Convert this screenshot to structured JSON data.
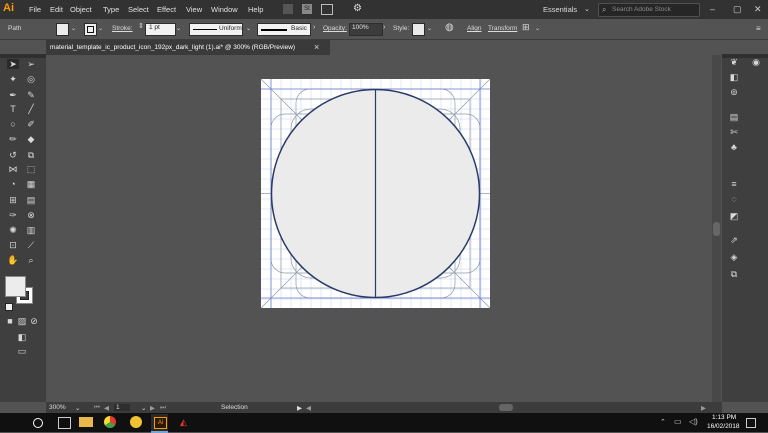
{
  "app": {
    "logo": "Ai"
  },
  "menu": [
    "File",
    "Edit",
    "Object",
    "Type",
    "Select",
    "Effect",
    "View",
    "Window",
    "Help"
  ],
  "workspace": "Essentials",
  "search": {
    "placeholder": "Search Adobe Stock"
  },
  "control": {
    "selection": "Path",
    "stroke_label": "Stroke:",
    "stroke_weight": "1 pt",
    "profile": "Uniform",
    "brush": "Basic",
    "opacity_label": "Opacity:",
    "opacity_value": "100%",
    "style_label": "Style:",
    "align": "Align",
    "transform": "Transform",
    "st_badge": "St"
  },
  "document": {
    "tab_title": "material_template_ic_product_icon_192px_dark_light (1).ai* @ 300% (RGB/Preview)",
    "close": "×"
  },
  "status": {
    "zoom": "300%",
    "artboard_num": "1",
    "mode": "Selection"
  },
  "taskbar": {
    "time": "1:13 PM",
    "date": "16/02/2018"
  },
  "colors": {
    "menubar": "#323232",
    "panel": "#535353",
    "toolbox": "#3f3f3f",
    "accent": "#ff9a00",
    "circle_stroke": "#2b3a67",
    "circle_fill": "#ebebeb",
    "guides": "#6a7fd6"
  }
}
